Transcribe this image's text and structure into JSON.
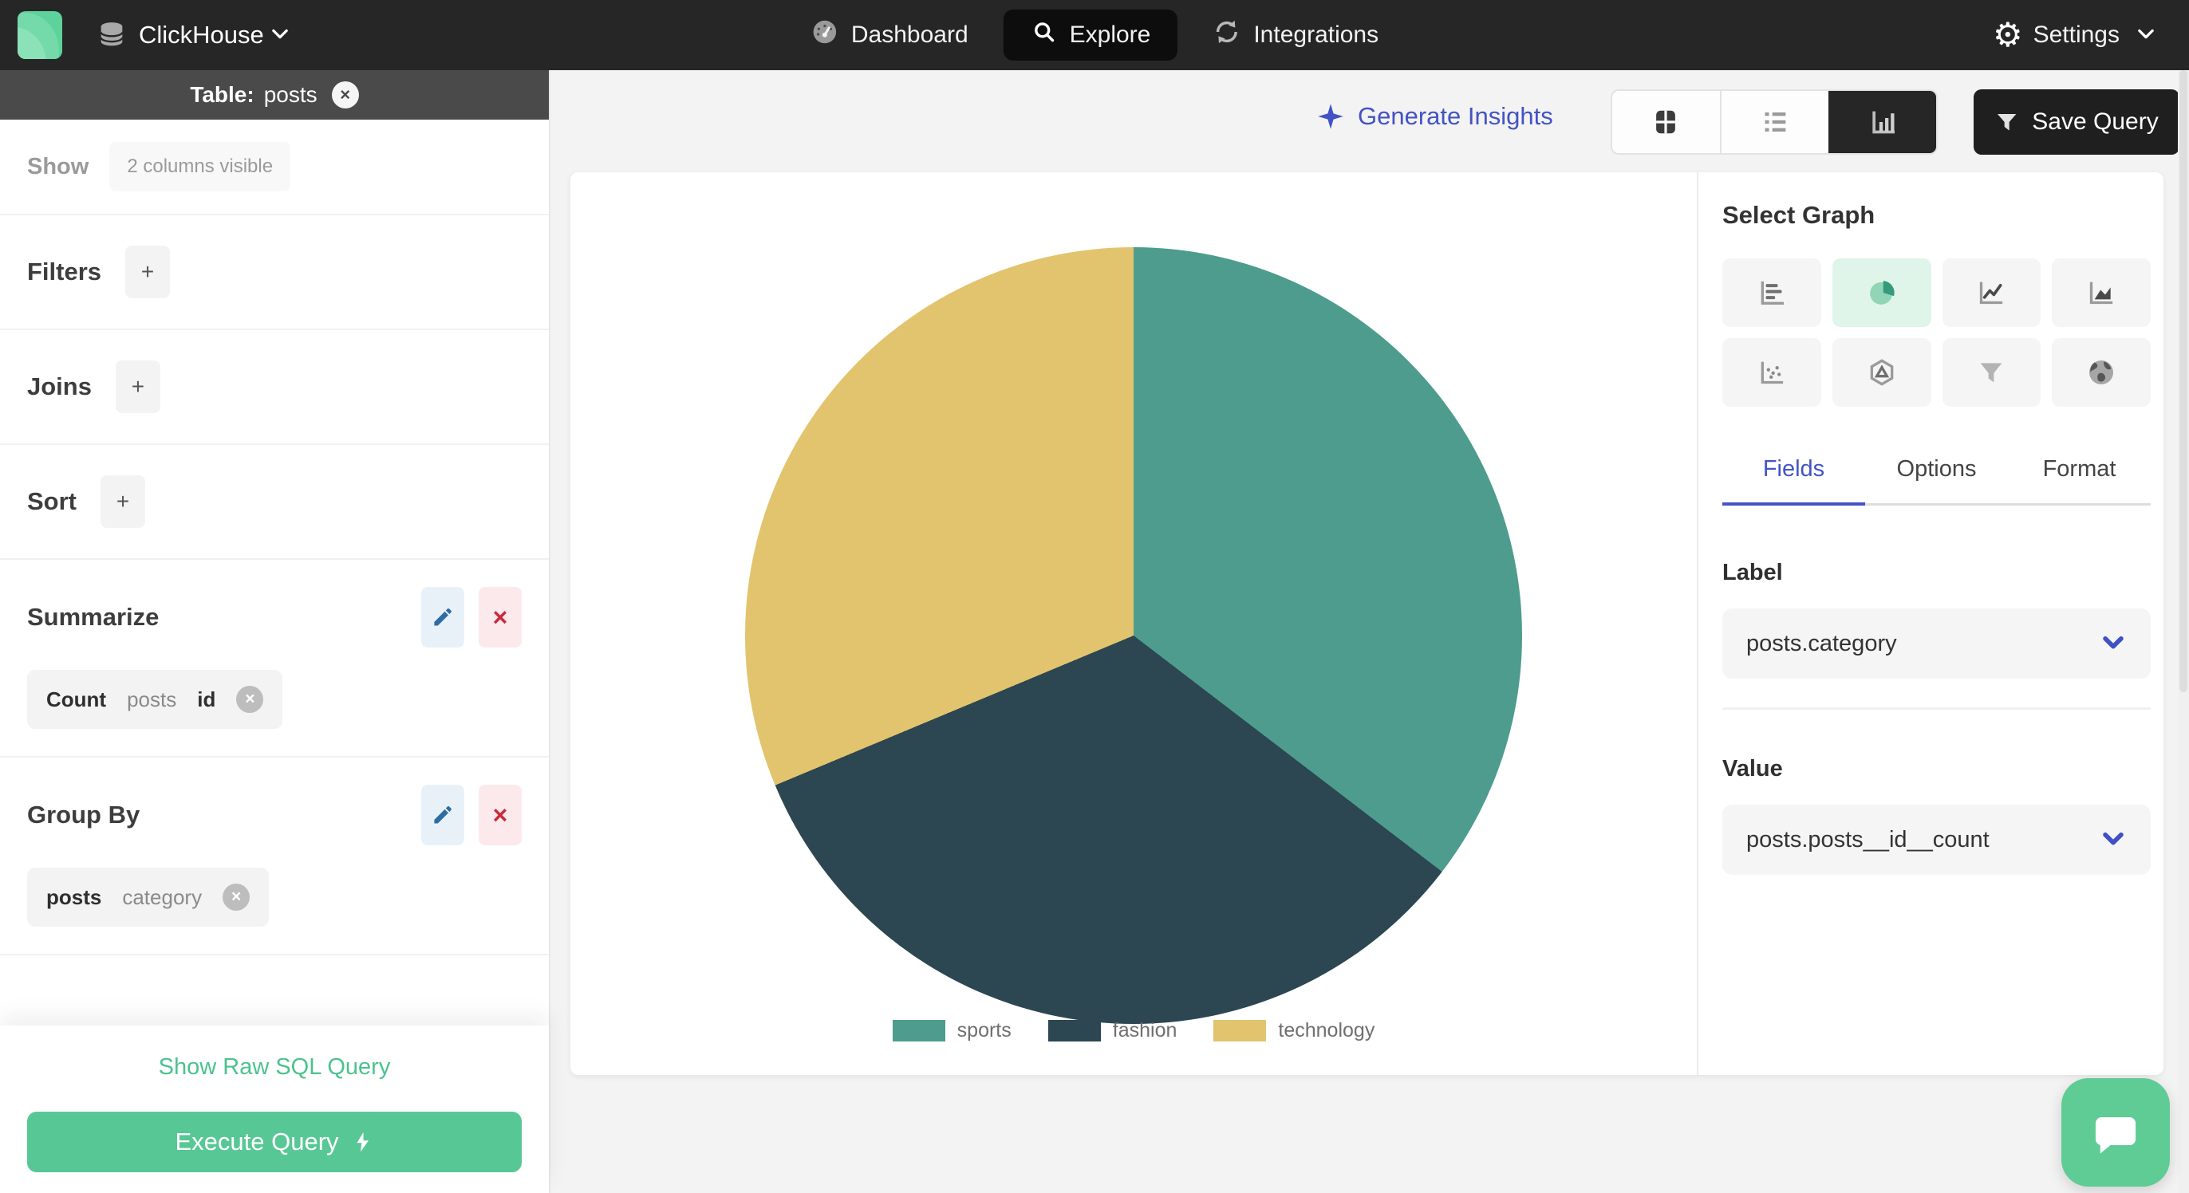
{
  "navbar": {
    "brand": "ClickHouse",
    "items": [
      {
        "label": "Dashboard",
        "icon": "gauge-icon",
        "active": false
      },
      {
        "label": "Explore",
        "icon": "search-icon",
        "active": true
      },
      {
        "label": "Integrations",
        "icon": "sync-icon",
        "active": false
      }
    ],
    "settings": {
      "label": "Settings",
      "icon": "gear-icon"
    }
  },
  "sidebar": {
    "table_header": {
      "prefix": "Table:",
      "table": "posts",
      "close_icon": "close-circle-icon"
    },
    "show_row": {
      "label": "Show",
      "chip": "2 columns visible"
    },
    "add_sections": [
      {
        "label": "Filters"
      },
      {
        "label": "Joins"
      },
      {
        "label": "Sort"
      }
    ],
    "add_symbol": "+",
    "summarize": {
      "title": "Summarize",
      "chip": {
        "agg": "Count",
        "table": "posts",
        "column": "id"
      }
    },
    "group_by": {
      "title": "Group By",
      "chip": {
        "table": "posts",
        "column": "category"
      }
    },
    "raw_sql_link": "Show Raw SQL Query",
    "execute_button": "Execute Query"
  },
  "toolbar": {
    "generate_insights": "Generate Insights",
    "view_icons": [
      "table-view-icon",
      "list-view-icon",
      "bar-chart-view-icon"
    ],
    "active_view": "bar-chart-view",
    "save_query": "Save Query"
  },
  "graph_panel": {
    "title": "Select Graph",
    "graph_types": [
      {
        "name": "horizontal-bar",
        "active": false
      },
      {
        "name": "pie",
        "active": true
      },
      {
        "name": "line",
        "active": false
      },
      {
        "name": "area",
        "active": false
      },
      {
        "name": "scatter",
        "active": false
      },
      {
        "name": "radar",
        "active": false
      },
      {
        "name": "funnel",
        "active": false
      },
      {
        "name": "geo-map",
        "active": false
      }
    ],
    "tabs": [
      {
        "label": "Fields",
        "active": true
      },
      {
        "label": "Options",
        "active": false
      },
      {
        "label": "Format",
        "active": false
      }
    ],
    "label_field": {
      "heading": "Label",
      "value": "posts.category"
    },
    "value_field": {
      "heading": "Value",
      "value": "posts.posts__id__count"
    }
  },
  "chart_data": {
    "type": "pie",
    "title": "",
    "categories": [
      "sports",
      "fashion",
      "technology"
    ],
    "series": [
      {
        "name": "sports",
        "percent": 35.4,
        "color": "#4D9C8D"
      },
      {
        "name": "fashion",
        "percent": 33.3,
        "color": "#2C4652"
      },
      {
        "name": "technology",
        "percent": 31.3,
        "color": "#E2C46E"
      }
    ],
    "legend_position": "bottom",
    "start_angle_deg": 0
  },
  "colors": {
    "nav_bg": "#262626",
    "accent_blue": "#4353C5",
    "brand_green": "#57C795",
    "link_green": "#4CC28E",
    "pie_active_bg": "#DFF5EA",
    "edit_blue": "#2E6DA4",
    "delete_red": "#C92A3C"
  }
}
